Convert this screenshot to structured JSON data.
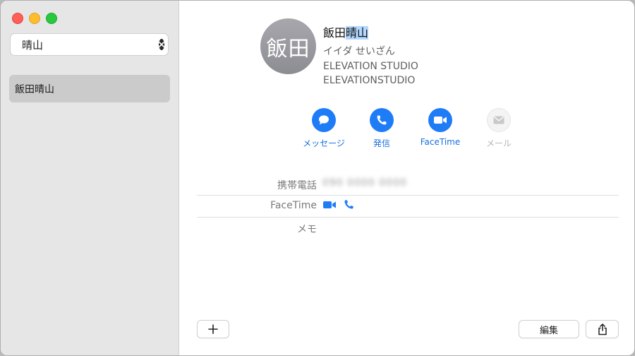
{
  "search": {
    "value": "晴山",
    "placeholder": ""
  },
  "results": [
    {
      "name": "飯田晴山"
    }
  ],
  "contact": {
    "avatar_initials": "飯田",
    "name_plain": "飯田",
    "name_selected": "晴山",
    "kana": "イイダ せいざん",
    "company": "ELEVATION STUDIO",
    "department": "ELEVATIONSTUDIO"
  },
  "actions": [
    {
      "label": "メッセージ",
      "icon": "message-bubble-icon",
      "enabled": true
    },
    {
      "label": "発信",
      "icon": "phone-icon",
      "enabled": true
    },
    {
      "label": "FaceTime",
      "icon": "video-camera-icon",
      "enabled": true
    },
    {
      "label": "メール",
      "icon": "envelope-icon",
      "enabled": false
    }
  ],
  "fields": [
    {
      "key": "携帯電話",
      "value": "090 0000 0000"
    },
    {
      "key": "FaceTime",
      "value": ""
    },
    {
      "key": "メモ",
      "value": ""
    }
  ],
  "footer": {
    "add_label": "+",
    "edit_label": "編集"
  },
  "colors": {
    "accent": "#1f7cf7",
    "sidebar": "#e6e6e6",
    "selection": "#cbcbcb"
  }
}
